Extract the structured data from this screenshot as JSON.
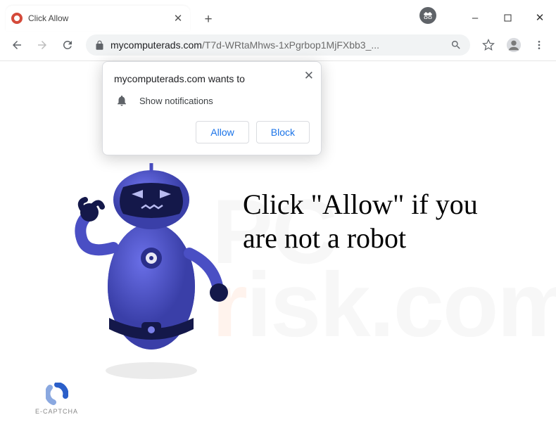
{
  "window": {
    "tab_title": "Click Allow",
    "minimize": "–",
    "maximize": "□",
    "close": "✕"
  },
  "toolbar": {
    "url_domain": "mycomputerads.com",
    "url_path": "/T7d-WRtaMhws-1xPgrbop1MjFXbb3_..."
  },
  "prompt": {
    "title": "mycomputerads.com wants to",
    "permission": "Show notifications",
    "allow_label": "Allow",
    "block_label": "Block"
  },
  "page": {
    "headline": "Click \"Allow\" if you are not a robot",
    "captcha_label": "E-CAPTCHA",
    "watermark_top": "PC",
    "watermark_bottom": "risk.com"
  }
}
